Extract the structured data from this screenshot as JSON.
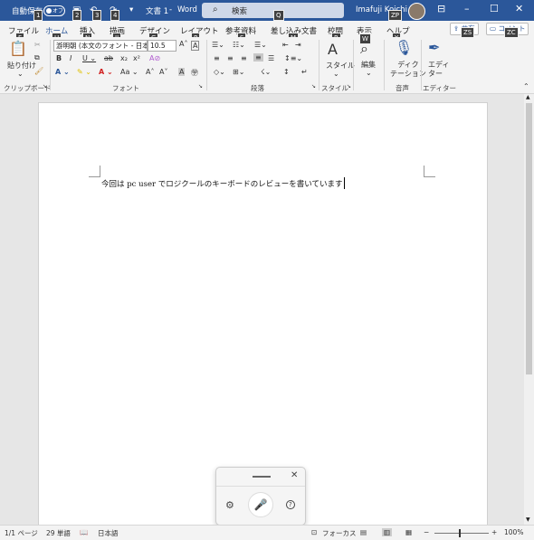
{
  "titlebar": {
    "autosave_label": "自動保存",
    "autosave_state": "オフ",
    "doc_title": "文書 1",
    "app_sep": "-",
    "app_name": "Word",
    "search_placeholder": "検索",
    "user_name": "Imafuji Koichi",
    "keytips": [
      "1",
      "2",
      "3",
      "4",
      "Q",
      "ZP"
    ],
    "brand_color": "#2b579a"
  },
  "tabs": [
    {
      "label": "ファイル",
      "keytip": "F"
    },
    {
      "label": "ホーム",
      "keytip": "H",
      "active": true
    },
    {
      "label": "挿入",
      "keytip": "N"
    },
    {
      "label": "描画",
      "keytip": "JI"
    },
    {
      "label": "デザイン",
      "keytip": "G"
    },
    {
      "label": "レイアウト",
      "keytip": "P"
    },
    {
      "label": "参考資料",
      "keytip": "S"
    },
    {
      "label": "差し込み文書",
      "keytip": "M"
    },
    {
      "label": "校閲",
      "keytip": "R"
    },
    {
      "label": "表示",
      "keytip": "W"
    },
    {
      "label": "ヘルプ",
      "keytip": "Y"
    }
  ],
  "share": {
    "share_label": "共有",
    "share_keytip": "ZS",
    "comment_label": "コメント",
    "comment_keytip": "ZC"
  },
  "ribbon": {
    "clipboard": {
      "paste_label": "貼り付け",
      "group_label": "クリップボード"
    },
    "font": {
      "font_name": "游明朝 (本文のフォント - 日本",
      "font_size": "10.5",
      "group_label": "フォント"
    },
    "paragraph": {
      "group_label": "段落"
    },
    "styles": {
      "styles_label": "スタイル",
      "group_label": "スタイル"
    },
    "editing": {
      "editing_label": "編集"
    },
    "voice": {
      "dictate_label": "ディク\nテーション",
      "group_label": "音声"
    },
    "editor": {
      "editor_label": "エディ\nター",
      "group_label": "エディター"
    }
  },
  "document": {
    "text": "今回は pc user でロジクールのキーボードのレビューを書いています"
  },
  "dictation": {
    "close_glyph": "✕",
    "help_glyph": "?"
  },
  "status": {
    "page": "1/1 ページ",
    "words": "29 単語",
    "language": "日本語",
    "focus": "フォーカス",
    "zoom": "100%"
  }
}
